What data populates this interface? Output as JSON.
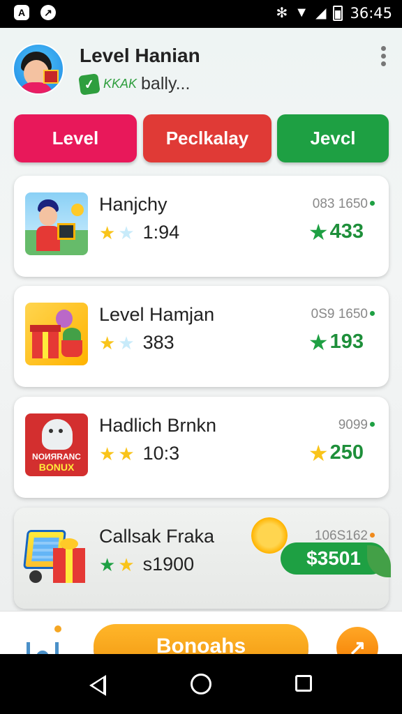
{
  "status_bar": {
    "left_icons": [
      "notification-a-icon",
      "compass-icon"
    ],
    "right_icons": [
      "bluetooth-icon",
      "wifi-icon",
      "signal-icon",
      "battery-icon"
    ],
    "time": "36:45"
  },
  "header": {
    "title": "Level Hanian",
    "subtitle_tag": "KKAK",
    "subtitle": "bally..."
  },
  "tabs": [
    {
      "label": "Level",
      "color": "#e8185a"
    },
    {
      "label": "Peclkalay",
      "color": "#e03a36"
    },
    {
      "label": "Jevcl",
      "color": "#1ea043"
    }
  ],
  "items": [
    {
      "name": "Hanjchy",
      "rating_count": "1:94",
      "code": "083 1650",
      "reward": "433"
    },
    {
      "name": "Level Hamjan",
      "rating_count": "383",
      "code": "0S9 1650",
      "reward": "193"
    },
    {
      "name": "Hadlich Brnkn",
      "rating_count": "10:3",
      "code": "9099",
      "reward": "250",
      "thumb_text_1": "NOИЯRANC",
      "thumb_text_2": "BONUX"
    },
    {
      "name": "Callsak Fraka",
      "rating_count": "s1900",
      "code": "106S162",
      "reward": "$3501"
    }
  ],
  "bottom_bar": {
    "cta_label": "Bonoahs"
  },
  "colors": {
    "green": "#1ea043",
    "gold": "#f9c41a",
    "orange": "#f29a12"
  }
}
